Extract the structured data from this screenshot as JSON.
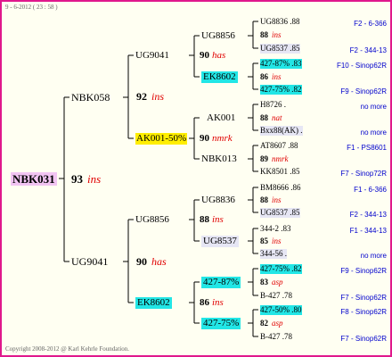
{
  "date": "9 - 6-2012 ( 23 : 58 )",
  "footer": "Copyright 2008-2012 @ Karl Kehrle Foundation.",
  "root": {
    "name": "NBK031",
    "num": "93",
    "tag": "ins"
  },
  "g1": {
    "sire": {
      "name": "NBK058",
      "num": "92",
      "tag": "ins"
    },
    "dam": {
      "name": "UG9041",
      "num": "90",
      "tag": "has"
    }
  },
  "g2": {
    "ss": {
      "name": "UG9041",
      "num": "90",
      "tag": "has"
    },
    "sd": {
      "name": "AK001-50%",
      "num": "90",
      "tag": "nmrk"
    },
    "ds": {
      "name": "UG8856",
      "num": "88",
      "tag": "ins"
    },
    "dd": {
      "name": "EK8602",
      "num": "86",
      "tag": "ins"
    }
  },
  "g3": {
    "sss": {
      "name": "UG8856",
      "num": "88",
      "tag": "ins"
    },
    "ssd": {
      "name": "EK8602",
      "num": "86",
      "tag": "ins"
    },
    "sds": {
      "name": "AK001",
      "num": "88",
      "tag": "nat"
    },
    "sdd": {
      "name": "NBK013",
      "num": "89",
      "tag": "nmrk"
    },
    "dss": {
      "name": "UG8836",
      "num": "88",
      "tag": "ins"
    },
    "dsd": {
      "name": "UG8537",
      "num": "85",
      "tag": "ins"
    },
    "dds": {
      "name": "427-87%",
      "num": "83",
      "tag": "asp"
    },
    "ddd": {
      "name": "427-75%",
      "num": "82",
      "tag": "asp"
    }
  },
  "g4": [
    {
      "name": "UG8836 .88",
      "origin": "F2 - 6-366"
    },
    {
      "name": "UG8537 .85",
      "origin": "F2 - 344-13"
    },
    {
      "name": "427-87% .83",
      "origin": "F10 - Sinop62R"
    },
    {
      "name": "427-75% .82",
      "origin": "F9 - Sinop62R"
    },
    {
      "name": "H8726 .",
      "origin": "no more"
    },
    {
      "name": "Bxx88(AK) .",
      "origin": "no more"
    },
    {
      "name": "AT8607 .88",
      "origin": "F1 - PS8601"
    },
    {
      "name": "KK8501 .85",
      "origin": "F7 - Sinop72R"
    },
    {
      "name": "BM8666 .86",
      "origin": "F1 - 6-366"
    },
    {
      "name": "UG8537 .85",
      "origin": "F2 - 344-13"
    },
    {
      "name": "344-2 .83",
      "origin": "F1 - 344-13"
    },
    {
      "name": "344-56 .",
      "origin": "no more"
    },
    {
      "name": "427-75% .82",
      "origin": "F9 - Sinop62R"
    },
    {
      "name": "B-427 .78",
      "origin": "F7 - Sinop62R"
    },
    {
      "name": "427-50% .80",
      "origin": "F8 - Sinop62R"
    },
    {
      "name": "B-427 .78",
      "origin": "F7 - Sinop62R"
    }
  ]
}
